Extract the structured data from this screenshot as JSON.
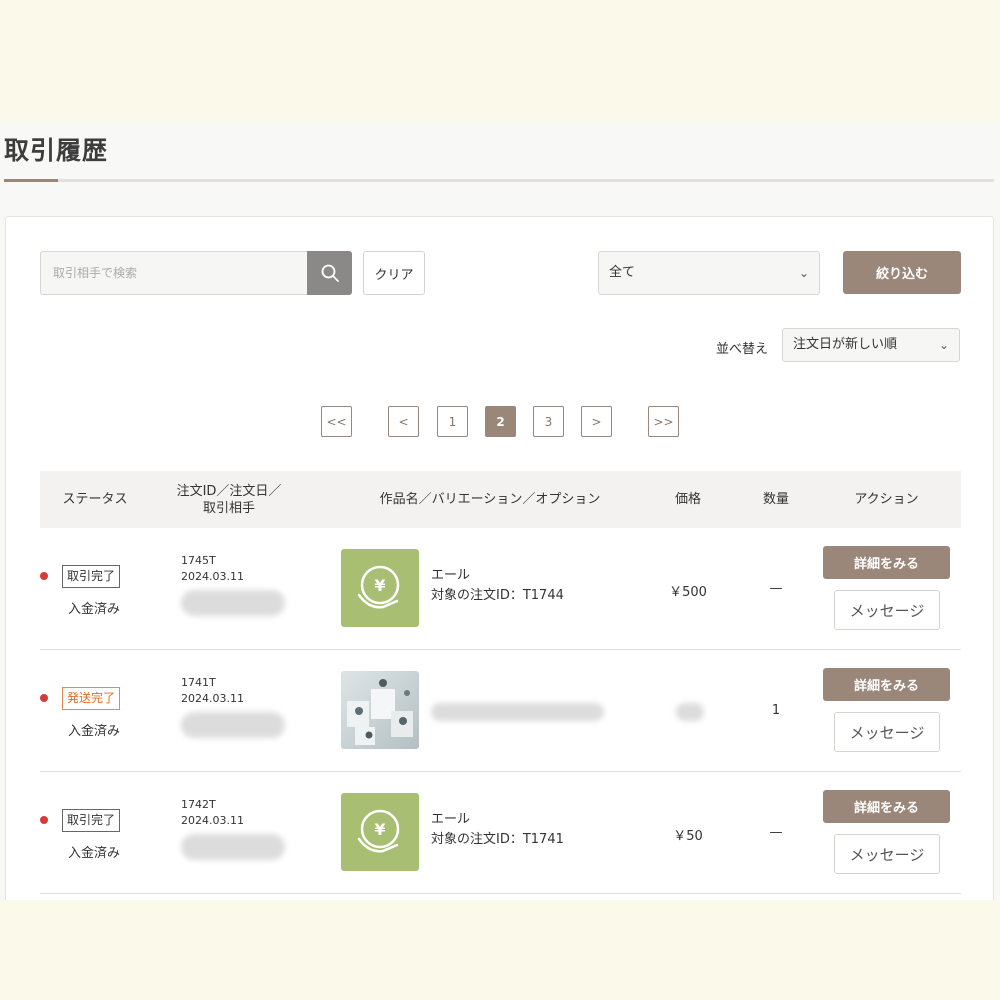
{
  "page": {
    "title": "取引履歴"
  },
  "filters": {
    "search_placeholder": "取引相手で検索",
    "clear_label": "クリア",
    "status_selected": "全て",
    "narrow_label": "絞り込む",
    "sort_label": "並べ替え",
    "sort_selected": "注文日が新しい順"
  },
  "pagination": {
    "first": "<<",
    "prev": "<",
    "pages": [
      "1",
      "2",
      "3"
    ],
    "current": "2",
    "next": ">",
    "last": ">>"
  },
  "table": {
    "headers": {
      "status": "ステータス",
      "order": "注文ID／注文日／取引相手",
      "product": "作品名／バリエーション／オプション",
      "price": "価格",
      "qty": "数量",
      "action": "アクション"
    },
    "rows": [
      {
        "status": "取引完了",
        "status_color": "#666666",
        "payment": "入金済み",
        "order_id": "1745T",
        "date": "2024.03.11",
        "product_name": "エール",
        "product_sub": "対象の注文ID：T1744",
        "price": "￥500",
        "qty": "—",
        "thumb_icon": "yen-hand-icon",
        "detail_label": "詳細をみる",
        "message_label": "メッセージ"
      },
      {
        "status": "発送完了",
        "status_color": "#e06d24",
        "payment": "入金済み",
        "order_id": "1741T",
        "date": "2024.03.11",
        "product_name": "",
        "product_sub": "",
        "price": "",
        "qty": "1",
        "thumb_icon": "product-photo",
        "detail_label": "詳細をみる",
        "message_label": "メッセージ"
      },
      {
        "status": "取引完了",
        "status_color": "#666666",
        "payment": "入金済み",
        "order_id": "1742T",
        "date": "2024.03.11",
        "product_name": "エール",
        "product_sub": "対象の注文ID：T1741",
        "price": "￥50",
        "qty": "—",
        "thumb_icon": "yen-hand-icon",
        "detail_label": "詳細をみる",
        "message_label": "メッセージ"
      }
    ]
  },
  "colors": {
    "accent": "#9a8779",
    "status_dot": "#d43c3c",
    "thumb_green": "#a8be72",
    "orange": "#e06d24"
  }
}
